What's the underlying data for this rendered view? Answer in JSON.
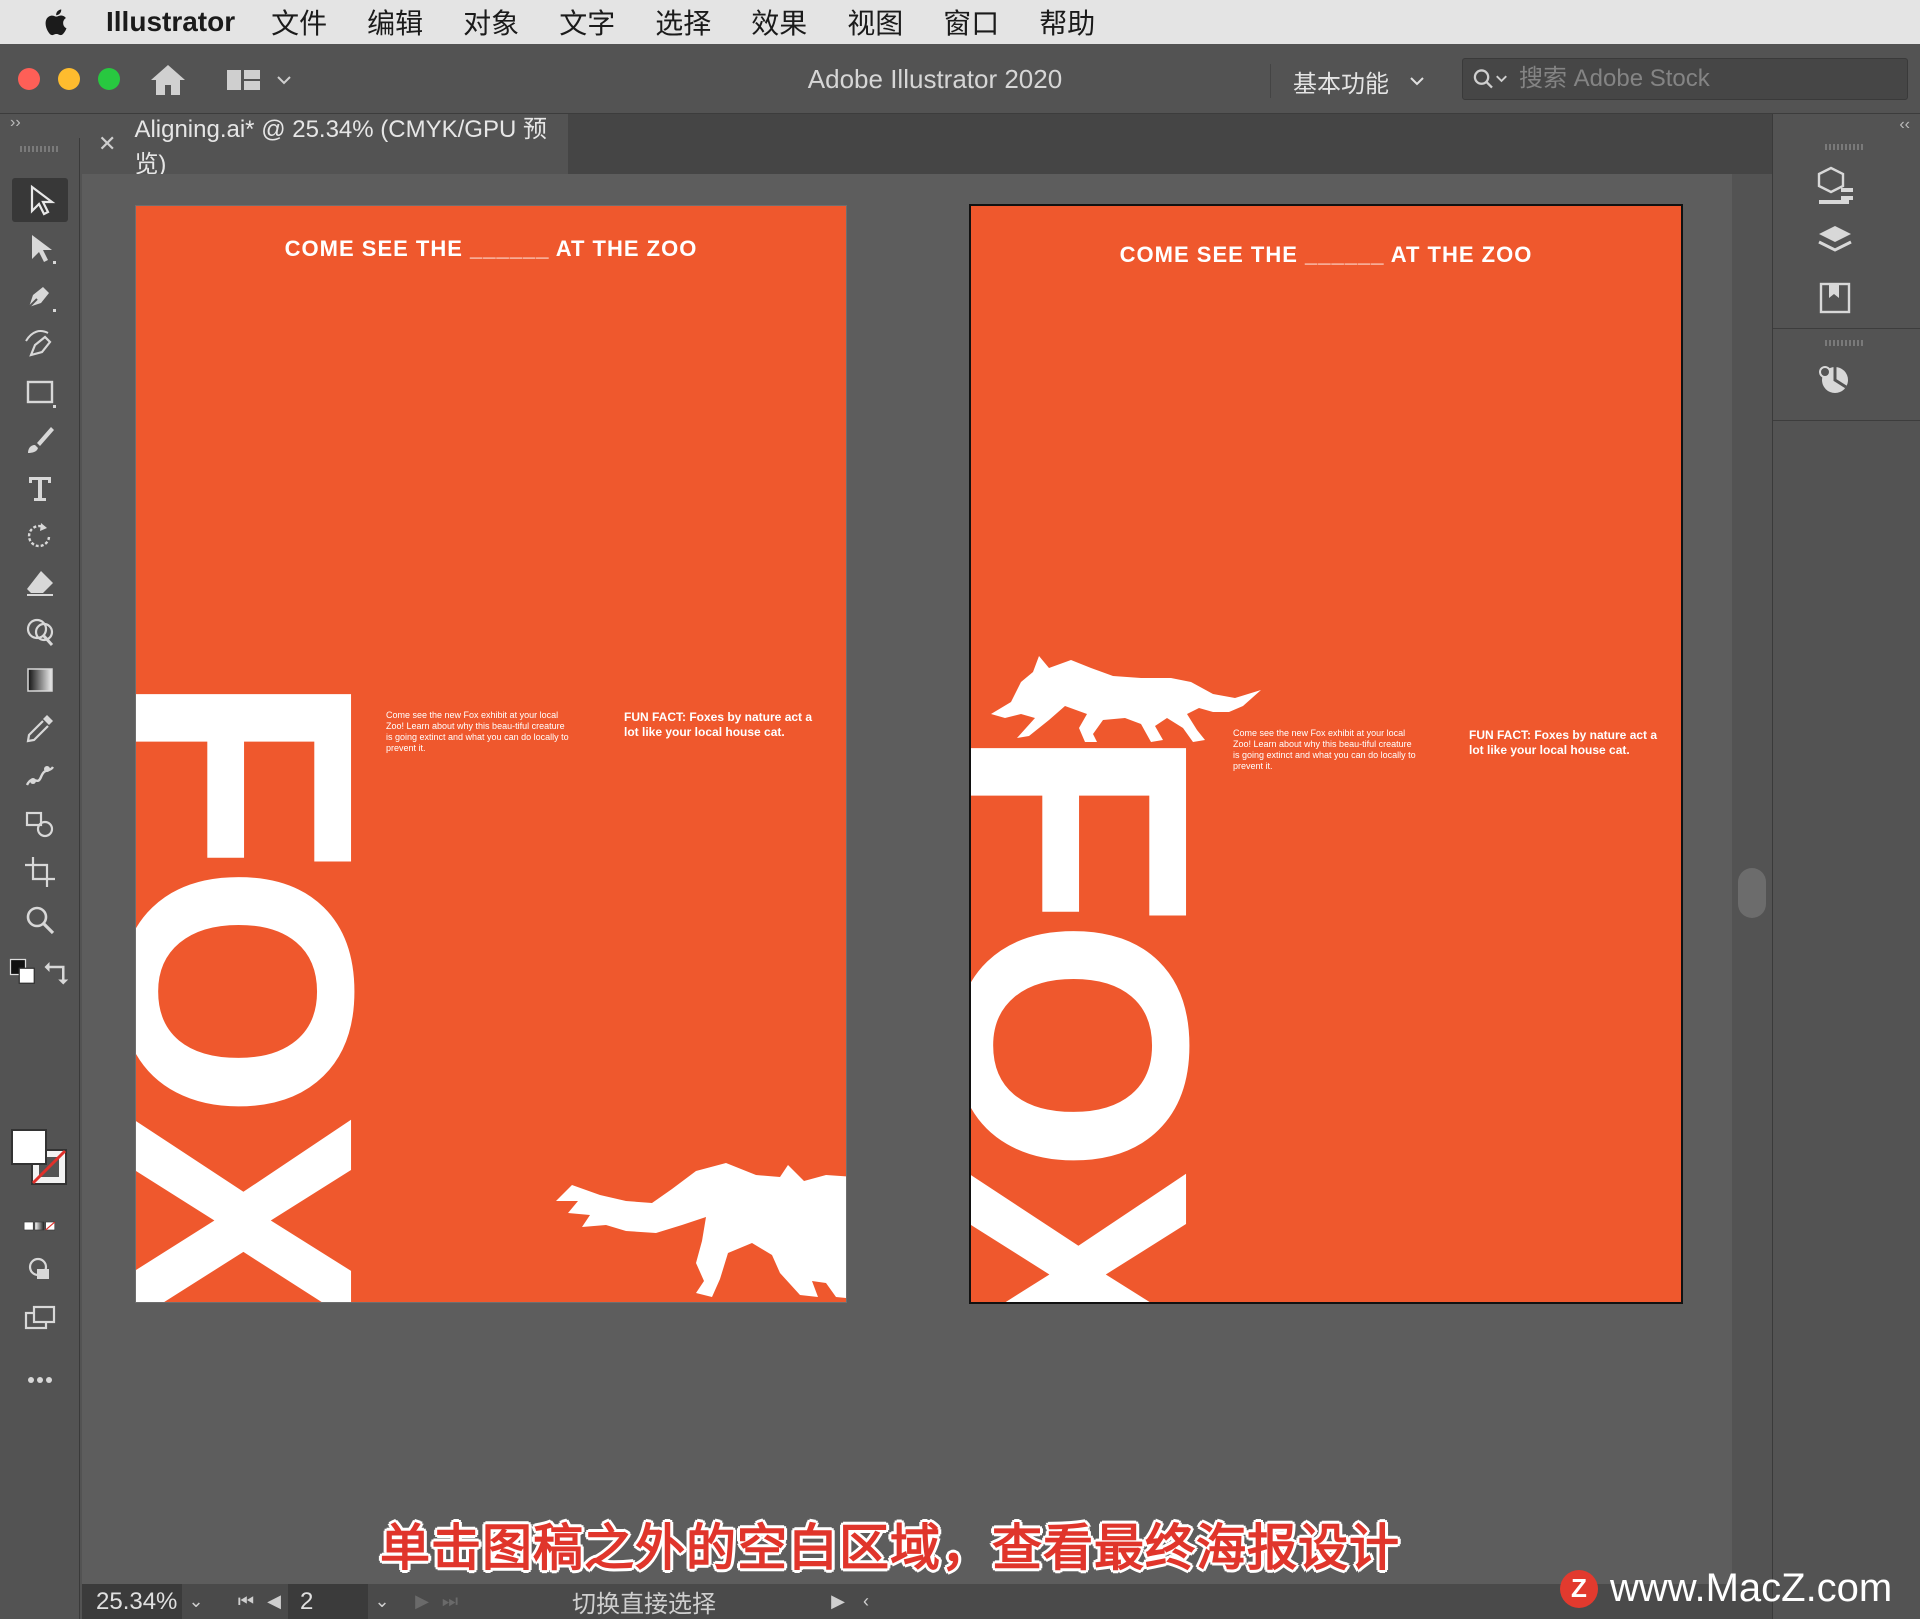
{
  "menubar": {
    "app_name": "Illustrator",
    "items": [
      "文件",
      "编辑",
      "对象",
      "文字",
      "选择",
      "效果",
      "视图",
      "窗口",
      "帮助"
    ]
  },
  "titlebar": {
    "title": "Adobe Illustrator 2020",
    "workspace": "基本功能",
    "search_placeholder": "搜索 Adobe Stock"
  },
  "document_tab": {
    "label": "Aligning.ai* @ 25.34% (CMYK/GPU 预览)"
  },
  "artboards": [
    {
      "headline": "COME SEE THE ______ AT THE ZOO",
      "body": "Come see the new Fox exhibit at your local Zoo! Learn about why this beau-tiful creature is going extinct and what you can do locally to prevent it.",
      "fun_fact": "FUN FACT: Foxes by nature act a lot like your local house cat.",
      "big_word": "FOX"
    },
    {
      "headline": "COME SEE THE ______ AT THE ZOO",
      "body": "Come see the new Fox exhibit at your local Zoo! Learn about why this beau-tiful creature is going extinct and what you can do locally to prevent it.",
      "fun_fact": "FUN FACT: Foxes by nature act a lot like your local house cat.",
      "big_word": "FOX"
    }
  ],
  "statusbar": {
    "zoom": "25.34%",
    "page": "2",
    "tool_status": "切换直接选择"
  },
  "subtitle": "单击图稿之外的空白区域，查看最终海报设计",
  "watermark": "www.MacZ.com",
  "colors": {
    "artboard_orange": "#ef582d",
    "canvas_gray": "#5d5d5d",
    "ui_dark": "#535353",
    "subtitle_red": "#e0352b"
  },
  "icons": {
    "toolbar": [
      "selection-tool-icon",
      "direct-selection-tool-icon",
      "pen-tool-icon",
      "curvature-tool-icon",
      "rectangle-tool-icon",
      "paintbrush-tool-icon",
      "type-tool-icon",
      "rotate-tool-icon",
      "eraser-tool-icon",
      "shape-builder-tool-icon",
      "gradient-tool-icon",
      "eyedropper-tool-icon",
      "puppet-warp-tool-icon",
      "symbol-sprayer-tool-icon",
      "artboard-tool-icon",
      "zoom-tool-icon"
    ],
    "right_panel": [
      "properties-panel-icon",
      "layers-panel-icon",
      "libraries-panel-icon",
      "color-guide-panel-icon"
    ]
  }
}
